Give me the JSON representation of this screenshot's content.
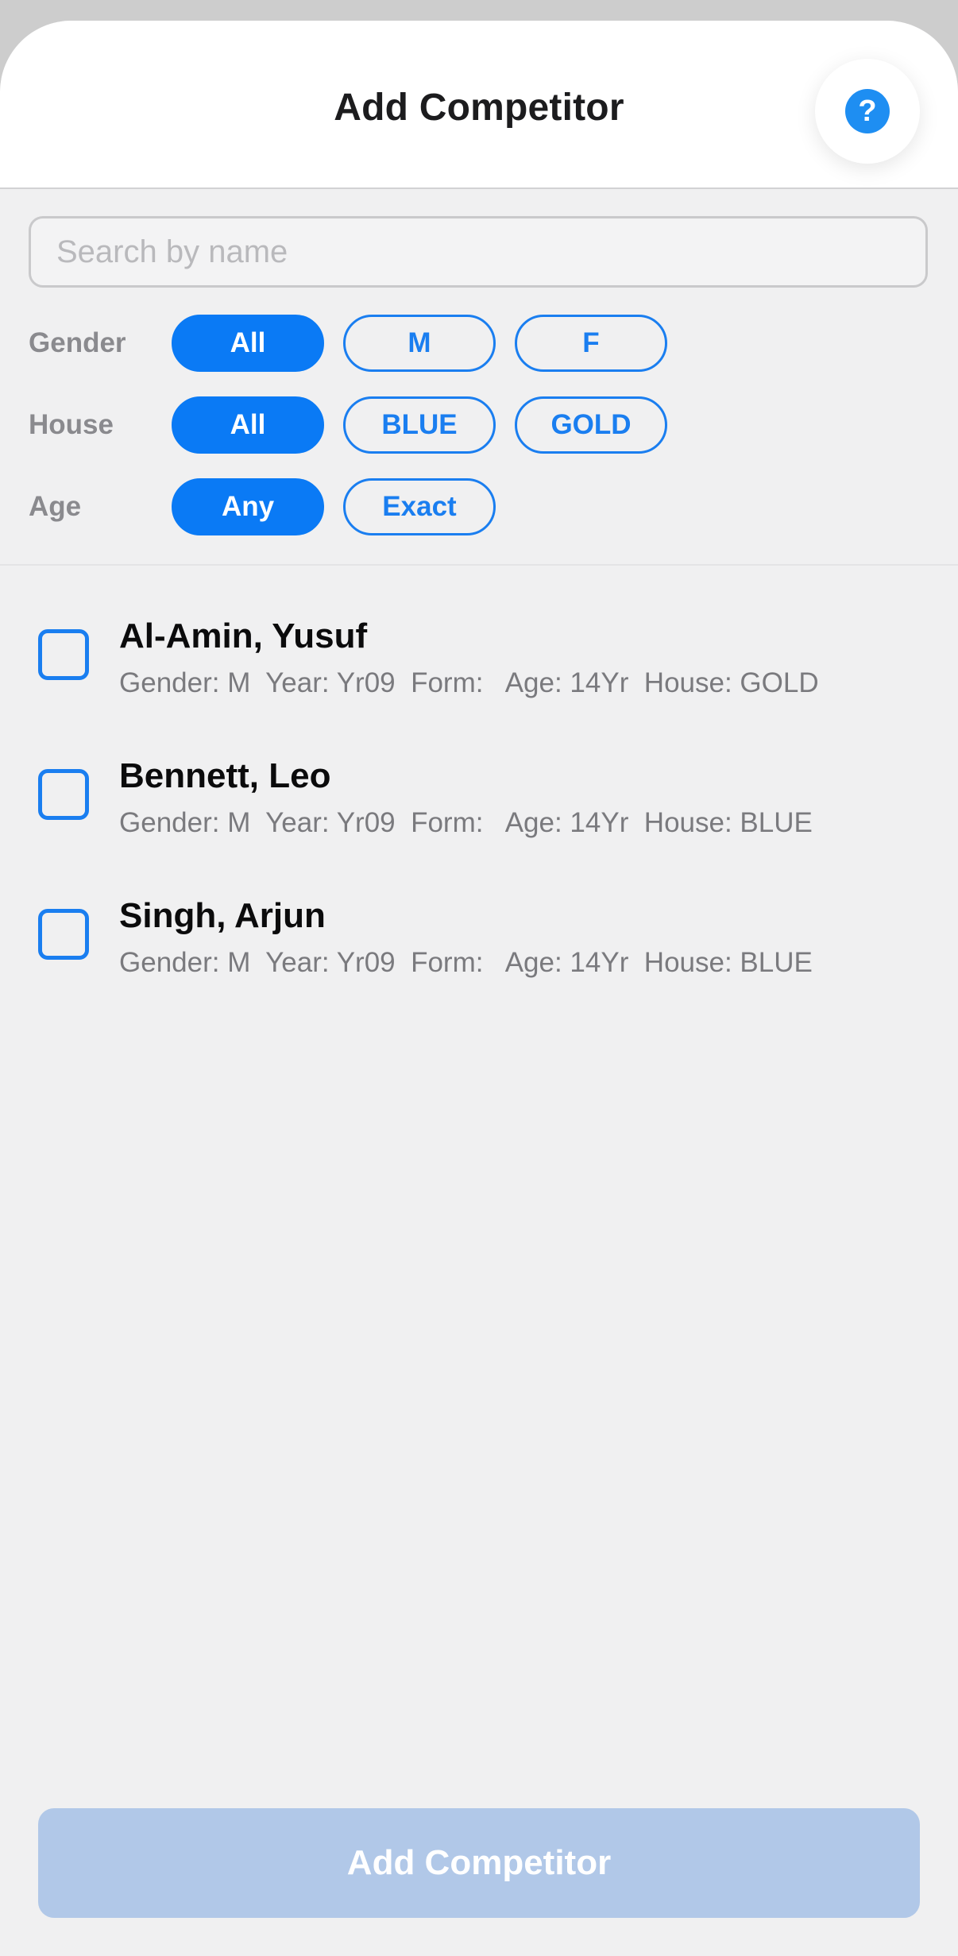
{
  "header": {
    "title": "Add Competitor",
    "help_icon_glyph": "?"
  },
  "search": {
    "placeholder": "Search by name",
    "value": ""
  },
  "filters": {
    "gender": {
      "label": "Gender",
      "options": [
        "All",
        "M",
        "F"
      ],
      "selected": "All"
    },
    "house": {
      "label": "House",
      "options": [
        "All",
        "BLUE",
        "GOLD"
      ],
      "selected": "All"
    },
    "age": {
      "label": "Age",
      "options": [
        "Any",
        "Exact"
      ],
      "selected": "Any"
    }
  },
  "competitors": [
    {
      "name": "Al-Amin, Yusuf",
      "details": "Gender: M  Year: Yr09  Form:   Age: 14Yr  House: GOLD",
      "checked": false
    },
    {
      "name": "Bennett, Leo",
      "details": "Gender: M  Year: Yr09  Form:   Age: 14Yr  House: BLUE",
      "checked": false
    },
    {
      "name": "Singh, Arjun",
      "details": "Gender: M  Year: Yr09  Form:   Age: 14Yr  House: BLUE",
      "checked": false
    }
  ],
  "footer": {
    "add_button_label": "Add Competitor"
  },
  "colors": {
    "accent": "#0a7af5",
    "help_icon": "#1e8ef2",
    "disabled_button": "#b1c8e8",
    "background": "#f0f0f1"
  }
}
